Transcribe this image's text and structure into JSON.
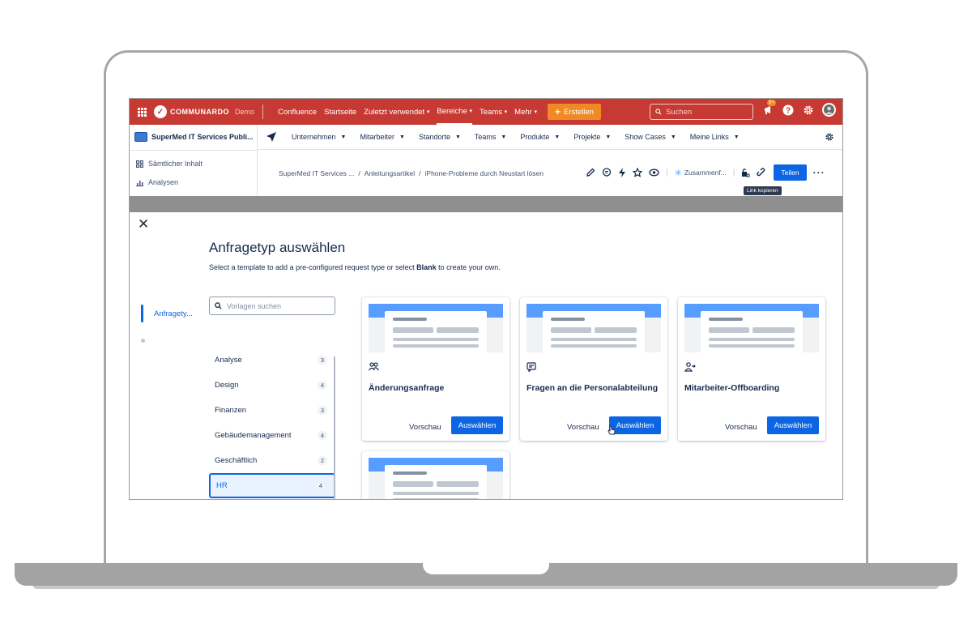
{
  "topbar": {
    "logo_text": "COMMUNARDO",
    "logo_demo": "Demo",
    "nav": [
      "Confluence",
      "Startseite",
      "Zuletzt verwendet",
      "Bereiche",
      "Teams",
      "Mehr"
    ],
    "create_label": "Erstellen",
    "search_placeholder": "Suchen",
    "notification_badge": "9+"
  },
  "space": {
    "title": "SuperMed IT Services Publi...",
    "items": [
      "Sämtlicher Inhalt",
      "Analysen"
    ]
  },
  "secondary_nav": [
    "Unternehmen",
    "Mitarbeiter",
    "Standorte",
    "Teams",
    "Produkte",
    "Projekte",
    "Show Cases",
    "Meine Links"
  ],
  "breadcrumb": {
    "items": [
      "SuperMed IT Services ...",
      "Anleitungsartikel",
      "iPhone-Probleme durch Neustart lösen"
    ],
    "separator": "/",
    "summary_label": "Zusammenf...",
    "share_label": "Teilen",
    "tooltip": "Link kopieren"
  },
  "modal": {
    "title": "Anfragetyp auswählen",
    "subtitle_pre": "Select a template to add a pre-configured request type or select ",
    "subtitle_bold": "Blank",
    "subtitle_post": " to create your own.",
    "step_label": "Anfragety...",
    "search_placeholder": "Vorlagen suchen",
    "categories": [
      {
        "label": "Analyse",
        "count": "3"
      },
      {
        "label": "Design",
        "count": "4"
      },
      {
        "label": "Finanzen",
        "count": "3"
      },
      {
        "label": "Gebäudemanagement",
        "count": "4"
      },
      {
        "label": "Geschäftlich",
        "count": "2"
      },
      {
        "label": "HR",
        "count": "4"
      }
    ],
    "cards": [
      {
        "title": "Änderungsanfrage",
        "icon": "people-icon"
      },
      {
        "title": "Fragen an die Personalabteilung",
        "icon": "comment-icon"
      },
      {
        "title": "Mitarbeiter-Offboarding",
        "icon": "person-leave-icon"
      }
    ],
    "preview_label": "Vorschau",
    "select_label": "Auswählen"
  },
  "colors": {
    "topbar": "#c73a33",
    "accent": "#0c66e4",
    "create": "#f08a24"
  }
}
